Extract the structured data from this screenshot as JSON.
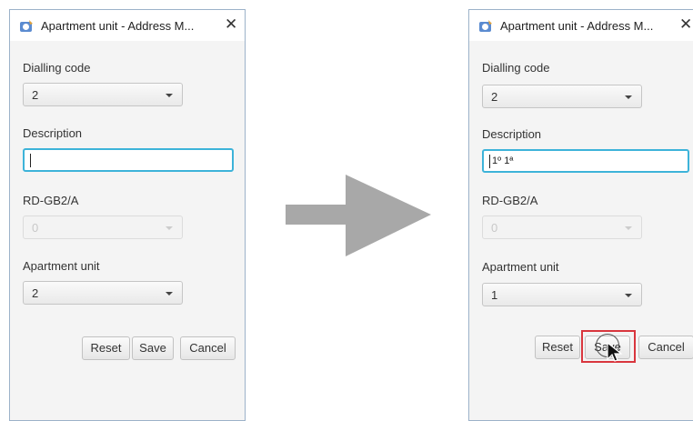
{
  "before": {
    "window_title": "Apartment unit - Address M...",
    "dialling_code_label": "Dialling code",
    "dialling_code_value": "2",
    "description_label": "Description",
    "description_value": "",
    "rd_label": "RD-GB2/A",
    "rd_value": "0",
    "apartment_label": "Apartment unit",
    "apartment_value": "2",
    "reset_label": "Reset",
    "save_label": "Save",
    "cancel_label": "Cancel"
  },
  "after": {
    "window_title": "Apartment unit - Address M...",
    "dialling_code_label": "Dialling code",
    "dialling_code_value": "2",
    "description_label": "Description",
    "description_value": "1º 1ª",
    "rd_label": "RD-GB2/A",
    "rd_value": "0",
    "apartment_label": "Apartment unit",
    "apartment_value": "1",
    "reset_label": "Reset",
    "save_label": "Save",
    "cancel_label": "Cancel"
  },
  "colors": {
    "focus_border": "#3db3d9",
    "highlight": "#d9363e",
    "arrow": "#a8a8a8"
  }
}
